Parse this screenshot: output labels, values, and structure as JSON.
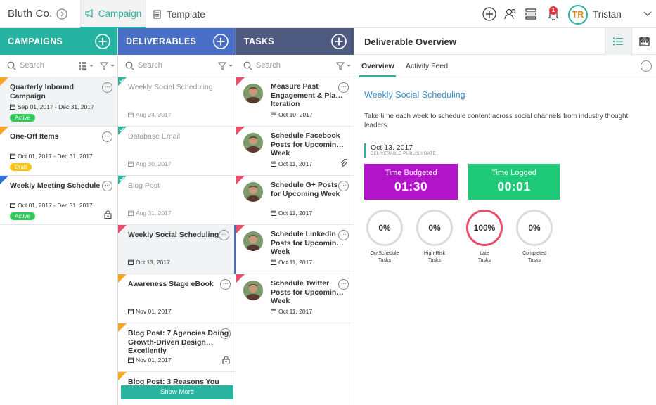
{
  "topbar": {
    "brand": "Bluth Co.",
    "tabs": [
      {
        "label": "Campaign",
        "active": true
      },
      {
        "label": "Template",
        "active": false
      }
    ],
    "notification_count": "1",
    "avatar_initials": "TR",
    "user_name": "Tristan",
    "accent": "#2ab4a0"
  },
  "campaigns": {
    "header": "CAMPAIGNS",
    "search_placeholder": "Search",
    "items": [
      {
        "title_1": "Quarterly Inbound",
        "title_2": "Campaign",
        "dates": "Sep 01, 2017 - Dec 31, 2017",
        "status": "Active",
        "corner": "orange",
        "selected": true
      },
      {
        "title_1": "One-Off Items",
        "dates": "Oct 01, 2017 - Dec 31, 2017",
        "status": "Draft",
        "corner": "orange"
      },
      {
        "title_1": "Weekly Meeting Schedule",
        "dates": "Oct 01, 2017 - Dec 31, 2017",
        "status": "Active",
        "corner": "blue",
        "locked": true
      }
    ]
  },
  "deliverables": {
    "header": "DELIVERABLES",
    "search_placeholder": "Search",
    "items": [
      {
        "title_1": "Weekly Social Scheduling",
        "date": "Aug 24, 2017",
        "corner": "teal",
        "completed": true
      },
      {
        "title_1": "Database Email",
        "date": "Aug 30, 2017",
        "corner": "teal",
        "completed": true
      },
      {
        "title_1": "Blog Post",
        "date": "Aug 31, 2017",
        "corner": "teal",
        "completed": true
      },
      {
        "title_1": "Weekly Social Scheduling",
        "date": "Oct 13, 2017",
        "corner": "red",
        "selected": true
      },
      {
        "title_1": "Awareness Stage eBook",
        "date": "Nov 01, 2017",
        "corner": "orange"
      },
      {
        "title_1": "Blog Post: 7 Agencies Doing",
        "title_2": "Growth-Driven Design…",
        "title_3": "Excellently",
        "date": "Nov 01, 2017",
        "corner": "orange",
        "locked": true
      },
      {
        "title_1": "Blog Post: 3 Reasons You",
        "corner": "orange"
      }
    ],
    "show_more": "Show More"
  },
  "tasks": {
    "header": "TASKS",
    "search_placeholder": "Search",
    "items": [
      {
        "title_1": "Measure Past",
        "title_2": "Engagement & Pla…",
        "title_3": "Iteration",
        "date": "Oct 10, 2017"
      },
      {
        "title_1": "Schedule Facebook",
        "title_2": "Posts for Upcomin…",
        "title_3": "Week",
        "date": "Oct 11, 2017",
        "attachment": true
      },
      {
        "title_1": "Schedule G+ Posts",
        "title_2": "for Upcoming Week",
        "date": "Oct 11, 2017"
      },
      {
        "title_1": "Schedule LinkedIn",
        "title_2": "Posts for Upcomin…",
        "title_3": "Week",
        "date": "Oct 11, 2017"
      },
      {
        "title_1": "Schedule Twitter",
        "title_2": "Posts for Upcomin…",
        "title_3": "Week",
        "date": "Oct 11, 2017"
      }
    ]
  },
  "overview": {
    "title": "Deliverable Overview",
    "tabs": [
      "Overview",
      "Activity Feed"
    ],
    "deliverable_name": "Weekly Social Scheduling",
    "description": "Take time each week to schedule content across social channels from industry thought leaders.",
    "publish_date": "Oct 13, 2017",
    "publish_label": "DELIVERABLE PUBLISH DATE",
    "time_budgeted_label": "Time Budgeted",
    "time_budgeted": "01:30",
    "time_logged_label": "Time Logged",
    "time_logged": "00:01",
    "stats": [
      {
        "value": "0%",
        "label_1": "On-Schedule",
        "label_2": "Tasks"
      },
      {
        "value": "0%",
        "label_1": "High-Risk",
        "label_2": "Tasks"
      },
      {
        "value": "100%",
        "label_1": "Late",
        "label_2": "Tasks"
      },
      {
        "value": "0%",
        "label_1": "Completed",
        "label_2": "Tasks"
      }
    ],
    "colors": {
      "budgeted": "#b114c9",
      "logged": "#1fcb79",
      "late": "#ea4d6a",
      "link": "#3a90cc"
    }
  }
}
